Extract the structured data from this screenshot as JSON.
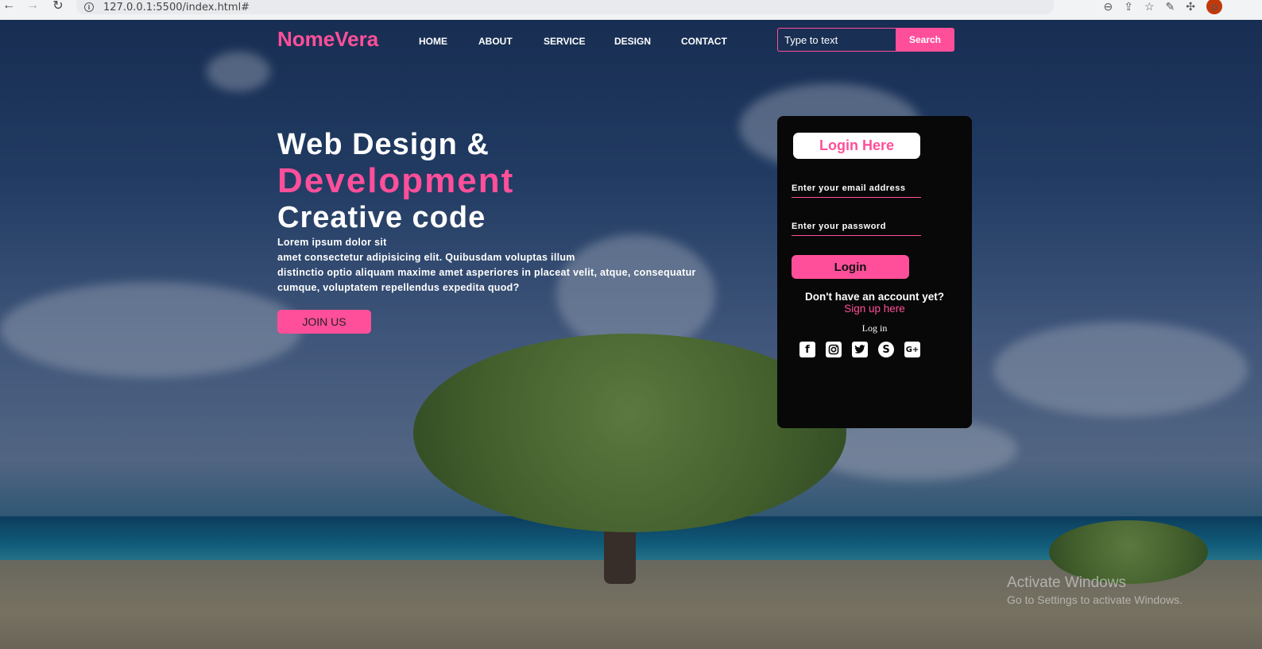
{
  "browser": {
    "url": "127.0.0.1:5500/index.html#",
    "profile_initial": "o"
  },
  "header": {
    "logo": "NomeVera",
    "nav": [
      "HOME",
      "ABOUT",
      "SERVICE",
      "DESIGN",
      "CONTACT"
    ],
    "search_placeholder": "Type to text",
    "search_button": "Search"
  },
  "hero": {
    "line1": "Web Design &",
    "line2": "Development",
    "line3": "Creative code",
    "para_lines": [
      "Lorem ipsum dolor sit",
      "amet consectetur adipisicing elit. Quibusdam voluptas illum",
      "distinctio optio aliquam maxime amet asperiores in placeat velit, atque, consequatur",
      "cumque, voluptatem repellendus expedita quod?"
    ],
    "join_button": "JOIN US"
  },
  "login": {
    "title": "Login Here",
    "email_placeholder": "Enter your email address",
    "password_placeholder": "Enter your password",
    "button": "Login",
    "no_account": "Don't have an account yet?",
    "signup_link": "Sign up here",
    "social_label": "Log in",
    "social_icons": [
      "facebook-icon",
      "instagram-icon",
      "twitter-icon",
      "skype-icon",
      "google-plus-icon"
    ]
  },
  "watermark": {
    "title": "Activate Windows",
    "subtitle": "Go to Settings to activate Windows."
  },
  "colors": {
    "accent": "#ff4f9a",
    "card": "#080808"
  }
}
